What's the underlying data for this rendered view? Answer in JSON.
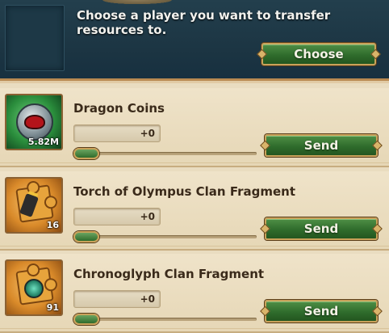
{
  "header": {
    "prompt": "Choose a player you want to transfer resources to.",
    "choose_label": "Choose"
  },
  "resources": [
    {
      "name": "Dragon Coins",
      "count": "5.82M",
      "amount": "+0",
      "slider_fraction": 0,
      "send_label": "Send",
      "icon": "dragon-coin-icon"
    },
    {
      "name": "Torch of Olympus Clan Fragment",
      "count": "16",
      "amount": "+0",
      "slider_fraction": 0,
      "send_label": "Send",
      "icon": "torch-fragment-icon"
    },
    {
      "name": "Chronoglyph Clan Fragment",
      "count": "91",
      "amount": "+0",
      "slider_fraction": 0,
      "send_label": "Send",
      "icon": "chronoglyph-fragment-icon"
    }
  ],
  "colors": {
    "header_bg": "#1b3442",
    "button_green": "#2f6c2c",
    "gold_trim": "#c9a25a",
    "panel_bg": "#e9dcc0"
  }
}
